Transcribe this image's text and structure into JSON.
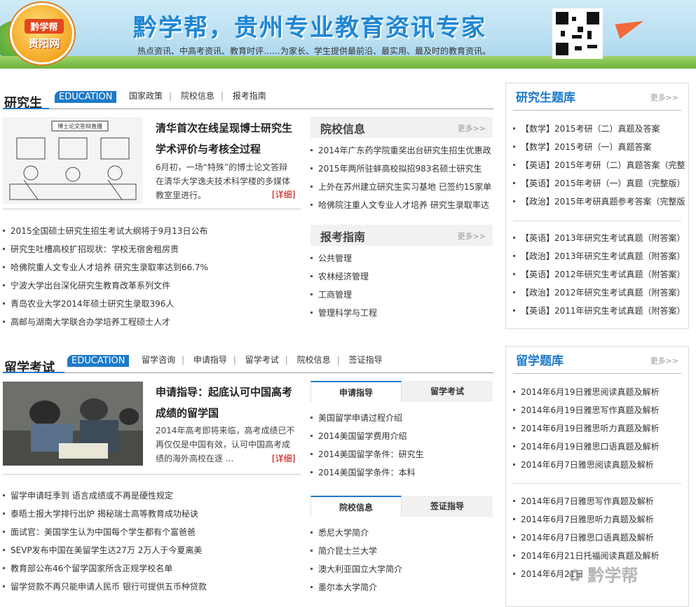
{
  "banner": {
    "logo_top": "黔学帮",
    "logo_bottom": "贵阳网",
    "title": "黔学帮，贵州专业教育资讯专家",
    "subtitle": "热点资讯、中高考资讯、教育时评……为家长、学生提供最前沿、最实用、最及时的教育资讯。",
    "qr_icon": "qr-code-icon"
  },
  "grad": {
    "title": "研究生",
    "tag": "EDUCATION",
    "nav": [
      "国家政策",
      "院校信息",
      "报考指南"
    ],
    "feature": {
      "title": "清华首次在线呈现博士研究生学术评价与考核全过程",
      "desc": "6月初，一场“特殊”的博士论文答辩在清华大学逸夫技术科学楼的多媒体教室里进行。",
      "more": "[详细]",
      "photo_caption": "博士论文答辩直播"
    },
    "news": [
      "2015全国硕士研究生招生考试大纲将于9月13日公布",
      "研究生吐槽高校扩招现状：学校无宿舍租房贵",
      "哈佛院重人文专业人才培养 研究生录取率达到66.7%",
      "宁波大学出台深化研究生教育改革系列文件",
      "青岛农业大学2014年硕士研究生录取396人",
      "高邮与湖南大学联合办学培养工程硕士人才"
    ],
    "school_box": {
      "title": "院校信息",
      "more": "更多>>",
      "items": [
        "2014年广东药学院重奖出台研究生招生优惠政",
        "2015年两所驻蚌高校拟招983名硕士研究生",
        "上外在苏州建立研究生实习基地 已签约15家单",
        "哈佛院注重人文专业人才培养 研究生录取率达"
      ]
    },
    "guide_box": {
      "title": "报考指南",
      "more": "更多>>",
      "items": [
        "公共管理",
        "农林经济管理",
        "工商管理",
        "管理科学与工程"
      ]
    }
  },
  "grad_bank": {
    "title": "研究生题库",
    "more": "更多>>",
    "items_a": [
      "【数学】2015考研（二）真题及答案",
      "【数学】2015考研（一）真题答案",
      "【英语】2015年考研（二）真题答案（完整",
      "【英语】2015年考研（一）真题（完整版）",
      "【政治】2015年考研真题参考答案（完整版"
    ],
    "items_b": [
      "【英语】2013年研究生考试真题（附答案）",
      "【政治】2013年研究生考试真题（附答案）",
      "【英语】2012年研究生考试真题（附答案）",
      "【政治】2012年研究生考试真题（附答案）",
      "【英语】2011年研究生考试真题（附答案）"
    ]
  },
  "abroad": {
    "title": "留学考试",
    "tag": "EDUCATION",
    "nav": [
      "留学咨询",
      "申请指导",
      "留学考试",
      "院校信息",
      "签证指导"
    ],
    "feature": {
      "title": "申请指导：起底认可中国高考成绩的留学国",
      "desc": "2014年高考即将来临，高考成绩已不再仅仅是中国有效，认可中国高考成绩的海外高校在逐 ...",
      "more": "[详细]"
    },
    "news": [
      "留学申请旺季到 语言成绩或不再是硬性规定",
      "泰晤士报大学排行出炉 揭秘瑞士高等教育成功秘诀",
      "面试官：美国学生认为中国每个学生都有个富爸爸",
      "SEVP发布中国在美留学生达27万 2万人于今夏离美",
      "教育部公布46个留学国家所含正规学校名单",
      "留学贷款不再只能申请人民币 银行可提供五币种贷款"
    ],
    "tabs_a": [
      "申请指导",
      "留学考试"
    ],
    "items_a": [
      "美国留学申请过程介绍",
      "2014美国留学费用介绍",
      "2014美国留学条件：研究生",
      "2014美国留学条件：本科"
    ],
    "tabs_b": [
      "院校信息",
      "签证指导"
    ],
    "items_b": [
      "悉尼大学简介",
      "简介昆士兰大学",
      "澳大利亚国立大学简介",
      "墨尔本大学简介"
    ]
  },
  "abroad_bank": {
    "title": "留学题库",
    "more": "更多>>",
    "items_a": [
      "2014年6月19日雅思阅读真题及解析",
      "2014年6月19日雅思写作真题及解析",
      "2014年6月19日雅思听力真题及解析",
      "2014年6月19日雅思口语真题及解析",
      "2014年6月7日雅思阅读真题及解析"
    ],
    "items_b": [
      "2014年6月7日雅思写作真题及解析",
      "2014年6月7日雅思听力真题及解析",
      "2014年6月7日雅思口语真题及解析",
      "2014年6月21日托福阅读真题及解析",
      "2014年6月21日"
    ]
  },
  "watermark": "黔学帮",
  "colors": {
    "accent": "#1d7ac9",
    "detail": "#cc0000"
  }
}
